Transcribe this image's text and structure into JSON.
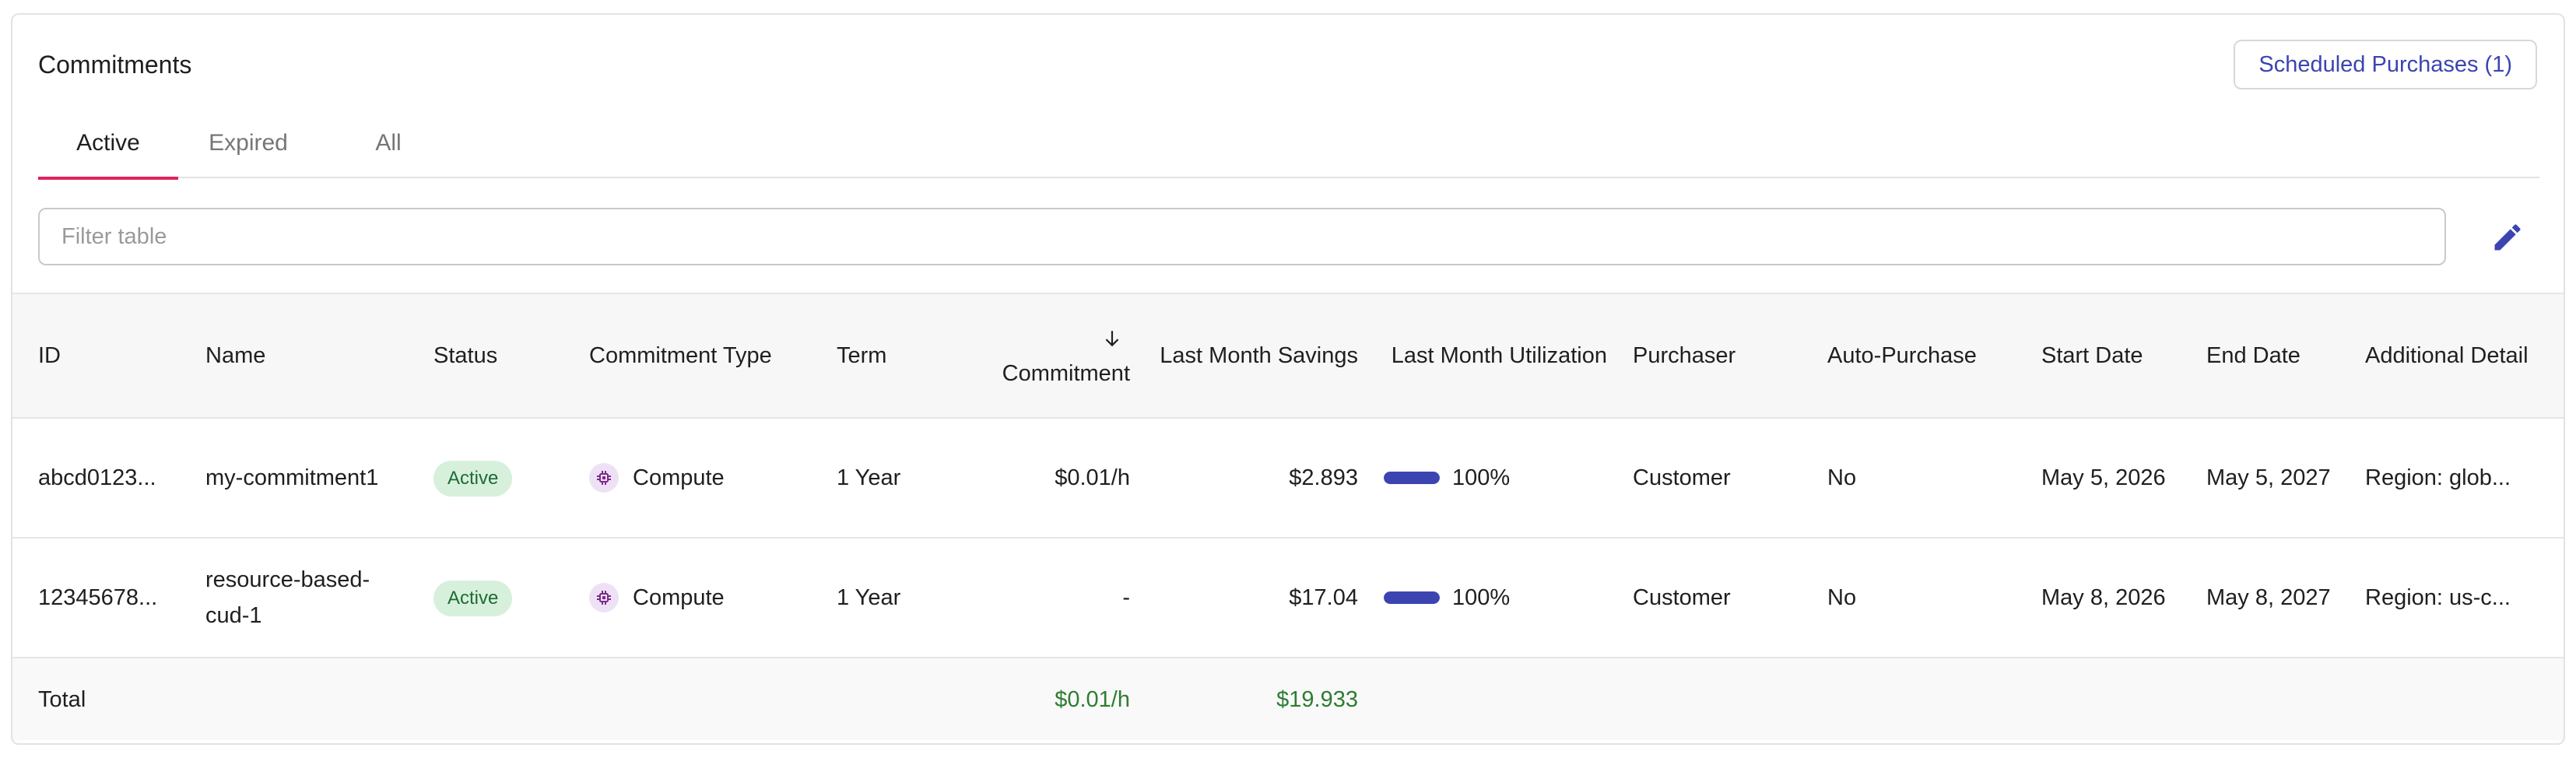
{
  "header": {
    "title": "Commitments",
    "scheduled_button": "Scheduled Purchases (1)"
  },
  "tabs": [
    {
      "label": "Active",
      "active": true
    },
    {
      "label": "Expired",
      "active": false
    },
    {
      "label": "All",
      "active": false
    }
  ],
  "filter": {
    "placeholder": "Filter table",
    "value": ""
  },
  "icons": {
    "edit": "pencil-icon",
    "sort": "arrow-down-icon",
    "compute": "chip-icon"
  },
  "colors": {
    "accent": "#3c44b1",
    "tab_indicator": "#e0245e",
    "active_badge_bg": "#d7f0dc",
    "total_green": "#2e7d32"
  },
  "table": {
    "columns": {
      "id": "ID",
      "name": "Name",
      "status": "Status",
      "type": "Commitment Type",
      "term": "Term",
      "commitment": "Commitment",
      "savings": "Last Month Savings",
      "utilization": "Last Month Utilization",
      "purchaser": "Purchaser",
      "auto": "Auto-Purchase",
      "start": "Start Date",
      "end": "End Date",
      "detail": "Additional Detail"
    },
    "rows": [
      {
        "id": "abcd0123...",
        "name": "my-commitment1",
        "status": "Active",
        "type": "Compute",
        "term": "1 Year",
        "commitment": "$0.01/h",
        "savings": "$2.893",
        "utilization": "100%",
        "utilization_fraction": 1.0,
        "purchaser": "Customer",
        "auto": "No",
        "start": "May 5, 2026",
        "end": "May 5, 2027",
        "detail": "Region: glob..."
      },
      {
        "id": "12345678...",
        "name": "resource-based-cud-1",
        "status": "Active",
        "type": "Compute",
        "term": "1 Year",
        "commitment": "-",
        "savings": "$17.04",
        "utilization": "100%",
        "utilization_fraction": 1.0,
        "purchaser": "Customer",
        "auto": "No",
        "start": "May 8, 2026",
        "end": "May 8, 2027",
        "detail": "Region: us-c..."
      }
    ],
    "total": {
      "label": "Total",
      "commitment": "$0.01/h",
      "savings": "$19.933"
    }
  }
}
